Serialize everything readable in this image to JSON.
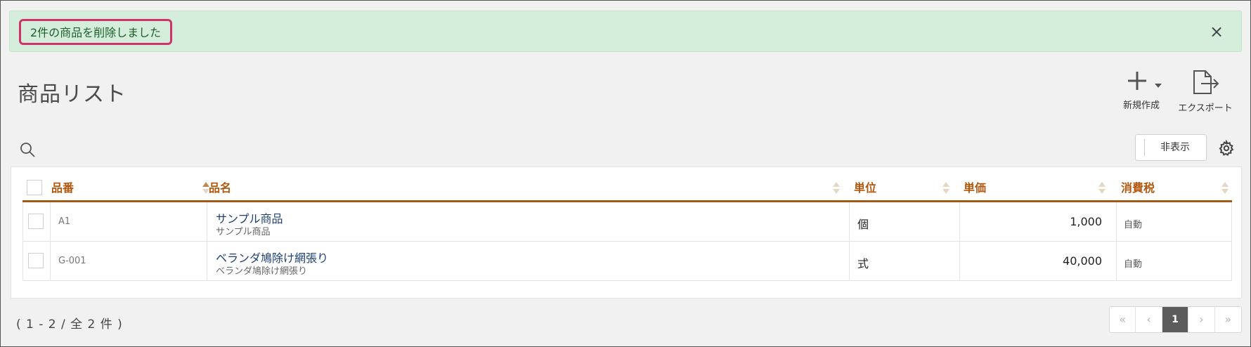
{
  "alert": {
    "message": "2件の商品を削除しました",
    "close": "×"
  },
  "header": {
    "title": "商品リスト"
  },
  "toolbar": {
    "new_label": "新規作成",
    "export_label": "エクスポート",
    "hide_label": "非表示"
  },
  "table": {
    "columns": [
      "品番",
      "品名",
      "単位",
      "単価",
      "消費税"
    ],
    "rows": [
      {
        "code": "A1",
        "name": "サンプル商品",
        "subname": "サンプル商品",
        "unit": "個",
        "price": "1,000",
        "tax": "自動"
      },
      {
        "code": "G-001",
        "name": "ベランダ鳩除け網張り",
        "subname": "ベランダ鳩除け網張り",
        "unit": "式",
        "price": "40,000",
        "tax": "自動"
      }
    ]
  },
  "footer": {
    "count": "( 1 - 2 / 全 2 件 )"
  },
  "pagination": {
    "first": "«",
    "prev": "‹",
    "current": "1",
    "next": "›",
    "last": "»"
  },
  "colors": {
    "accent": "#b1570e",
    "alert_bg": "#d4eedb",
    "highlight": "#d0336a",
    "link": "#1e3f73"
  }
}
